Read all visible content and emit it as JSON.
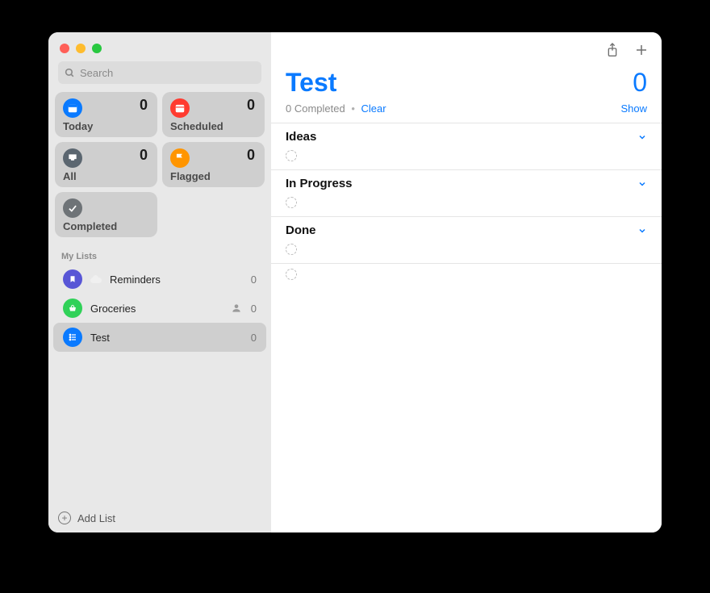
{
  "search": {
    "placeholder": "Search"
  },
  "smart": {
    "today": {
      "label": "Today",
      "count": "0"
    },
    "scheduled": {
      "label": "Scheduled",
      "count": "0"
    },
    "all": {
      "label": "All",
      "count": "0"
    },
    "flagged": {
      "label": "Flagged",
      "count": "0"
    },
    "completed": {
      "label": "Completed"
    }
  },
  "myListsHeader": "My Lists",
  "lists": [
    {
      "name": "Reminders",
      "count": "0"
    },
    {
      "name": "Groceries",
      "count": "0"
    },
    {
      "name": "Test",
      "count": "0"
    }
  ],
  "addList": "Add List",
  "main": {
    "title": "Test",
    "count": "0",
    "completedLine": "0 Completed",
    "clear": "Clear",
    "show": "Show",
    "sections": [
      {
        "title": "Ideas"
      },
      {
        "title": "In Progress"
      },
      {
        "title": "Done"
      }
    ]
  }
}
